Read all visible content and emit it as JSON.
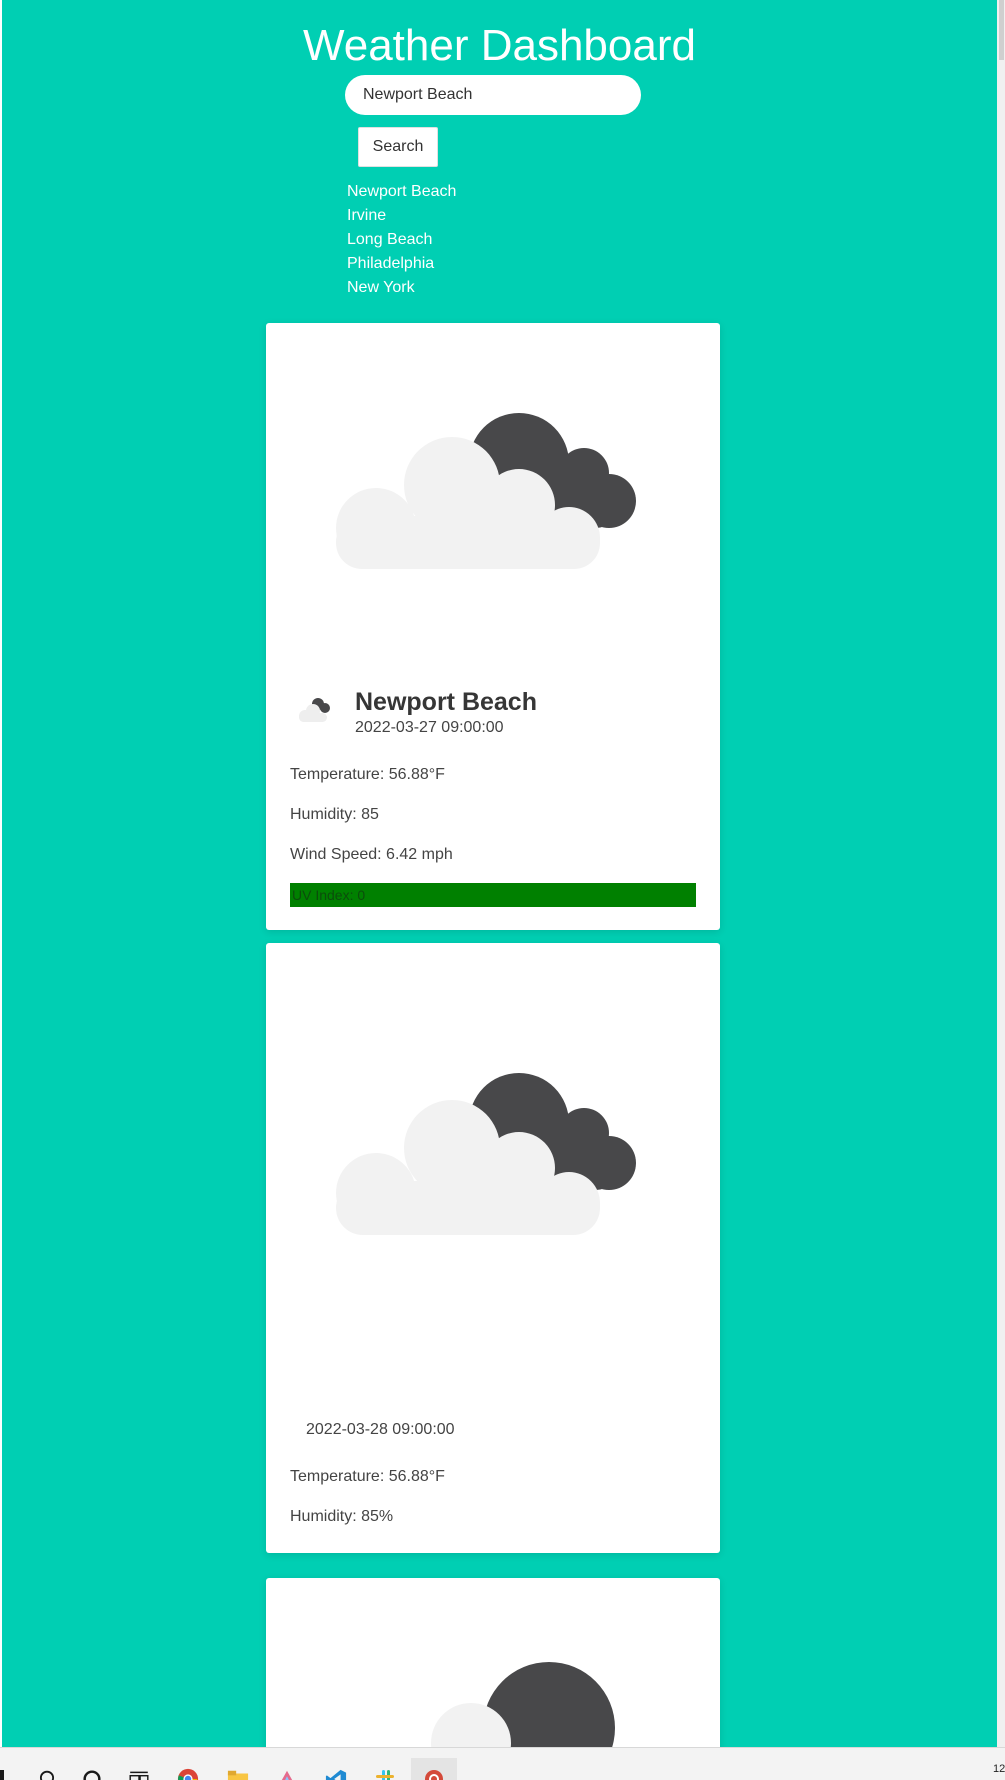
{
  "page": {
    "title": "Weather Dashboard"
  },
  "search": {
    "value": "Newport Beach",
    "button_label": "Search"
  },
  "history": [
    "Newport Beach",
    "Irvine",
    "Long Beach",
    "Philadelphia",
    "New York"
  ],
  "colors": {
    "background": "#00cfb3",
    "uv_index_good": "#008000",
    "cloud_light": "#f2f2f2",
    "cloud_dark": "#48484a"
  },
  "current": {
    "city": "Newport Beach",
    "datetime": "2022-03-27 09:00:00",
    "icon": "broken-clouds-icon",
    "temperature": "Temperature: 56.88°F",
    "humidity": "Humidity: 85",
    "wind": "Wind Speed: 6.42 mph",
    "uv": "UV Index: 0"
  },
  "forecast": [
    {
      "icon": "broken-clouds-icon",
      "datetime": "2022-03-28 09:00:00",
      "temperature": "Temperature: 56.88°F",
      "humidity": "Humidity: 85%"
    },
    {
      "icon": "broken-clouds-icon"
    }
  ],
  "taskbar": {
    "icons": [
      "windows-start-icon",
      "search-icon",
      "cortana-icon",
      "task-view-icon",
      "chrome-icon",
      "file-explorer-icon",
      "app-icon",
      "vscode-icon",
      "slack-icon",
      "app-icon"
    ],
    "clock": "12"
  }
}
